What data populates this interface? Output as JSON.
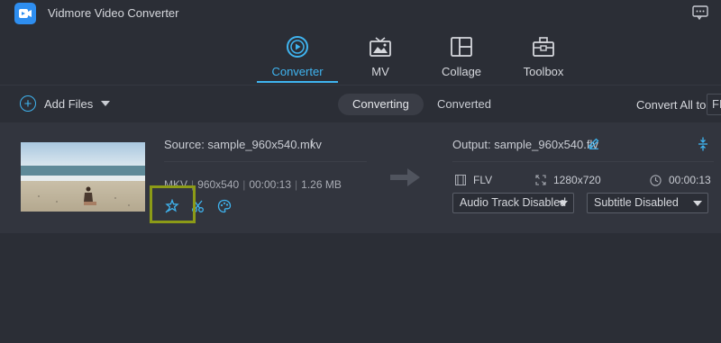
{
  "app": {
    "title": "Vidmore Video Converter"
  },
  "nav": {
    "tabs": [
      {
        "label": "Converter",
        "icon": "converter-icon",
        "active": true
      },
      {
        "label": "MV",
        "icon": "mv-icon",
        "active": false
      },
      {
        "label": "Collage",
        "icon": "collage-icon",
        "active": false
      },
      {
        "label": "Toolbox",
        "icon": "toolbox-icon",
        "active": false
      }
    ]
  },
  "toolbar": {
    "add_files": "Add Files",
    "segments": [
      "Converting",
      "Converted"
    ],
    "active_segment": "Converting",
    "convert_all_label": "Convert All to:",
    "convert_all_value": "FL"
  },
  "file": {
    "source": "Source: sample_960x540.mkv",
    "format": "MKV",
    "resolution": "960x540",
    "duration": "00:00:13",
    "size": "1.26 MB",
    "output": "Output: sample_960x540.flv",
    "out_format": "FLV",
    "out_resolution": "1280x720",
    "out_duration": "00:00:13",
    "audio": "Audio Track Disabled",
    "subtitle": "Subtitle Disabled"
  },
  "colors": {
    "accent": "#3fb4f0",
    "background": "#2b2e36",
    "row": "#32353e",
    "highlight": "#8c9b17"
  }
}
